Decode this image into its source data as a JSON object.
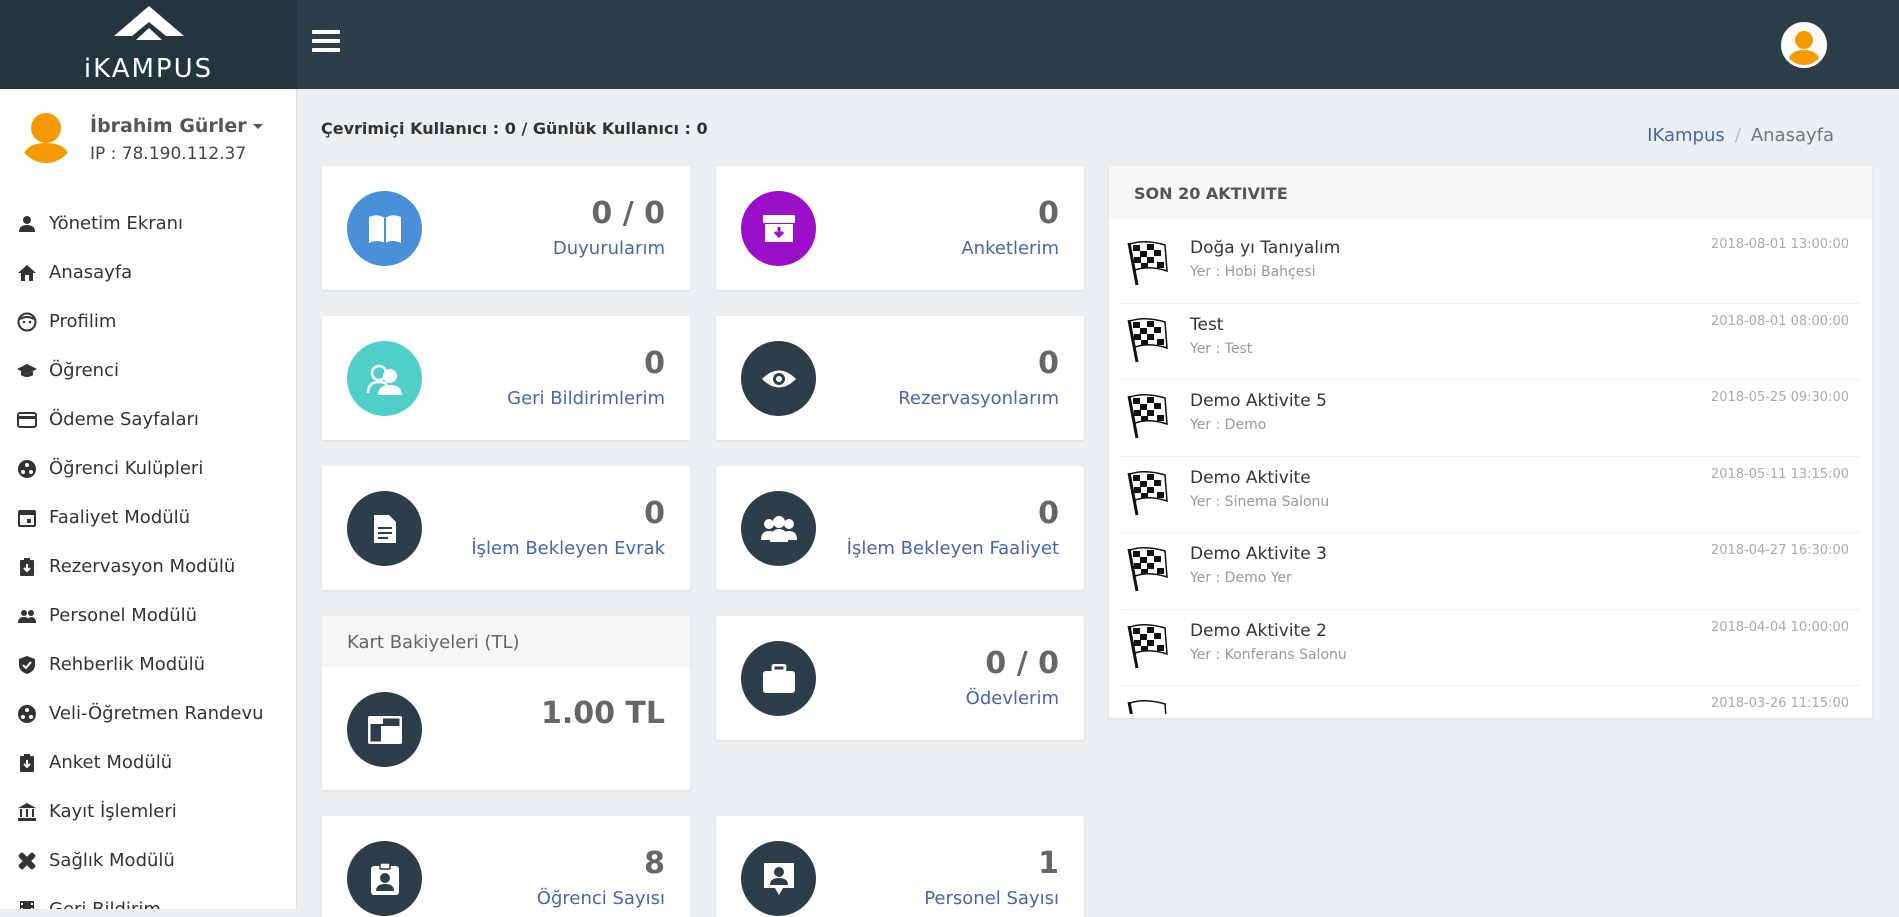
{
  "header": {
    "logo_text": "iKAMPUS",
    "menu_icon": "hamburger-icon",
    "profile_icon": "user-avatar-icon"
  },
  "user": {
    "name": "İbrahim Gürler",
    "ip": "IP : 78.190.112.37"
  },
  "sidebar": {
    "items": [
      {
        "label": "Yönetim Ekranı",
        "icon": "person-icon"
      },
      {
        "label": "Anasayfa",
        "icon": "home-icon"
      },
      {
        "label": "Profilim",
        "icon": "face-icon"
      },
      {
        "label": "Öğrenci",
        "icon": "graduation-cap-icon"
      },
      {
        "label": "Ödeme Sayfaları",
        "icon": "credit-card-icon"
      },
      {
        "label": "Öğrenci Kulüpleri",
        "icon": "club-icon"
      },
      {
        "label": "Faaliyet Modülü",
        "icon": "calendar-icon"
      },
      {
        "label": "Rezervasyon Modülü",
        "icon": "clipboard-download-icon"
      },
      {
        "label": "Personel Modülü",
        "icon": "people-icon"
      },
      {
        "label": "Rehberlik Modülü",
        "icon": "verified-shield-icon"
      },
      {
        "label": "Veli-Öğretmen Randevu",
        "icon": "club-icon"
      },
      {
        "label": "Anket Modülü",
        "icon": "clipboard-download-icon"
      },
      {
        "label": "Kayıt İşlemleri",
        "icon": "bank-icon"
      },
      {
        "label": "Sağlık Modülü",
        "icon": "bandage-icon"
      },
      {
        "label": "Geri Bildirim",
        "icon": "film-icon"
      }
    ]
  },
  "status": {
    "online": "Çevrimiçi Kullanıcı : 0 / Günlük Kullanıcı : 0"
  },
  "breadcrumb": {
    "home": "IKampus",
    "separator": "/",
    "current": "Anasayfa"
  },
  "cards": {
    "duyurular": {
      "value": "0 / 0",
      "label": "Duyurularım",
      "color": "#4a90d9",
      "icon": "book-icon"
    },
    "anketler": {
      "value": "0",
      "label": "Anketlerim",
      "color": "#9b0fc9",
      "icon": "archive-icon"
    },
    "geri_bildirim": {
      "value": "0",
      "label": "Geri Bildirimlerim",
      "color": "#4fcfc7",
      "icon": "users-icon"
    },
    "rezervasyon": {
      "value": "0",
      "label": "Rezervasyonlarım",
      "color": "#2c3e4a",
      "icon": "eye-icon"
    },
    "evrak": {
      "value": "0",
      "label": "İşlem Bekleyen Evrak",
      "color": "#2c3e4a",
      "icon": "document-icon"
    },
    "faaliyet": {
      "value": "0",
      "label": "İşlem Bekleyen Faaliyet",
      "color": "#2c3e4a",
      "icon": "group-icon"
    },
    "kart": {
      "title": "Kart Bakiyeleri (TL)",
      "value": "1.00 TL",
      "color": "#2c3e4a",
      "icon": "folder-icon"
    },
    "odevler": {
      "value": "0 / 0",
      "label": "Ödevlerim",
      "color": "#2c3e4a",
      "icon": "briefcase-icon"
    },
    "ogrenci_sayisi": {
      "value": "8",
      "label": "Öğrenci Sayısı",
      "color": "#2c3e4a",
      "icon": "id-badge-icon"
    },
    "personel_sayisi": {
      "value": "1",
      "label": "Personel Sayısı",
      "color": "#2c3e4a",
      "icon": "contact-icon"
    }
  },
  "activity": {
    "title": "SON 20 AKTIVITE",
    "items": [
      {
        "title": "Doğa yı Tanıyalım",
        "place": "Yer : Hobi Bahçesi",
        "time": "2018-08-01 13:00:00"
      },
      {
        "title": "Test",
        "place": "Yer : Test",
        "time": "2018-08-01 08:00:00"
      },
      {
        "title": "Demo Aktivite 5",
        "place": "Yer : Demo",
        "time": "2018-05-25 09:30:00"
      },
      {
        "title": "Demo Aktivite",
        "place": "Yer : Sinema Salonu",
        "time": "2018-05-11 13:15:00"
      },
      {
        "title": "Demo Aktivite 3",
        "place": "Yer : Demo Yer",
        "time": "2018-04-27 16:30:00"
      },
      {
        "title": "Demo Aktivite 2",
        "place": "Yer : Konferans Salonu",
        "time": "2018-04-04 10:00:00"
      },
      {
        "title": "",
        "place": "",
        "time": "2018-03-26 11:15:00"
      }
    ]
  }
}
